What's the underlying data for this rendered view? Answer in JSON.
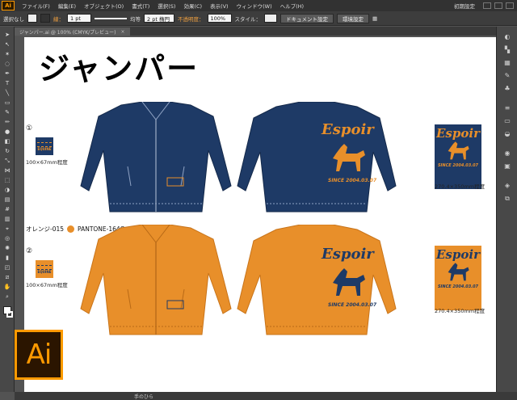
{
  "app": {
    "logo_text": "Ai",
    "workspace": "初期設定",
    "colors": {
      "orange": "#e88f2a",
      "navy": "#1e3a66",
      "brand": "#ff9a00"
    }
  },
  "menubar": {
    "items": [
      "ファイル(F)",
      "編集(E)",
      "オブジェクト(O)",
      "書式(T)",
      "選択(S)",
      "効果(C)",
      "表示(V)",
      "ウィンドウ(W)",
      "ヘルプ(H)"
    ]
  },
  "controlbar": {
    "selection_status": "選択なし",
    "stroke_label": "線：",
    "stroke_weight": "1 pt",
    "stroke_style": "均等",
    "brush_label": "2 pt 楕円",
    "opacity_label": "不透明度：",
    "opacity_value": "100%",
    "style_label": "スタイル：",
    "doc_settings_button": "ドキュメント設定",
    "prefs_button": "環境設定"
  },
  "tab": {
    "label": "ジャンパー.ai @ 100% (CMYK/プレビュー)",
    "close": "×"
  },
  "artwork": {
    "title": "ジャンパー",
    "section1_number": "①",
    "section2_number": "②",
    "logo_size": "100×67mm程度",
    "logo_size_2": "100×67mm程度",
    "back_size": "270.4×350mm程度",
    "back_size_2": "270.4×350mm程度",
    "color_name": "オレンジ-015",
    "pantone": "PANTONE-164C",
    "brand_title": "Espoir",
    "brand_since": "SINCE 2004.03.07",
    "chest_logo_text": "EQUINE"
  },
  "statusbar": {
    "tool_name": "手のひら"
  }
}
